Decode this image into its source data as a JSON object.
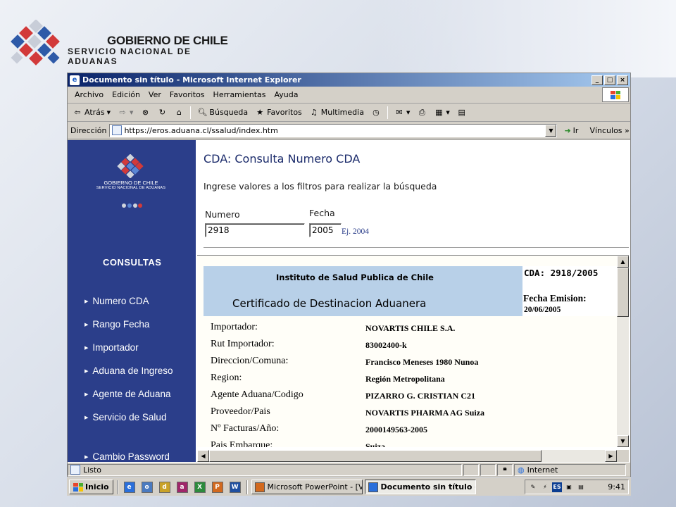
{
  "slide_header": {
    "title": "GOBIERNO DE CHILE",
    "subtitle": "SERVICIO NACIONAL DE ADUANAS"
  },
  "window": {
    "title": "Documento sin título - Microsoft Internet Explorer",
    "buttons": [
      "_",
      "□",
      "×"
    ]
  },
  "menu": [
    "Archivo",
    "Edición",
    "Ver",
    "Favoritos",
    "Herramientas",
    "Ayuda"
  ],
  "toolbar": {
    "back": "Atrás",
    "search": "Búsqueda",
    "favorites": "Favoritos",
    "media": "Multimedia"
  },
  "address": {
    "label": "Dirección",
    "url": "https://eros.aduana.cl/ssalud/index.htm",
    "go": "Ir",
    "links": "Vínculos"
  },
  "sidebar": {
    "logo_title": "GOBIERNO DE CHILE",
    "logo_sub": "SERVICIO NACIONAL DE ADUANAS",
    "heading": "CONSULTAS",
    "items": [
      {
        "label": "Numero CDA"
      },
      {
        "label": "Rango Fecha"
      },
      {
        "label": "Importador"
      },
      {
        "label": "Aduana de Ingreso"
      },
      {
        "label": "Agente de Aduana"
      },
      {
        "label": "Servicio de Salud"
      },
      {
        "label": "Cambio Password"
      }
    ]
  },
  "main": {
    "title": "CDA: Consulta Numero CDA",
    "instructions": "Ingrese valores a los filtros para realizar la búsqueda",
    "numero_label": "Numero",
    "numero_value": "2918",
    "fecha_label": "Fecha",
    "fecha_value": "2005",
    "fecha_hint": "Ej. 2004"
  },
  "certificate": {
    "institute": "Instituto de Salud Publica de Chile",
    "title": "Certificado de Destinacion Aduanera",
    "cda": "CDA: 2918/2005",
    "fecha_emision_label": "Fecha Emision:",
    "fecha_emision": "20/06/2005",
    "rows": [
      {
        "label": "Importador:",
        "value": "NOVARTIS CHILE S.A."
      },
      {
        "label": "Rut Importador:",
        "value": "83002400-k"
      },
      {
        "label": "Direccion/Comuna:",
        "value": "Francisco Meneses 1980 Nunoa"
      },
      {
        "label": "Region:",
        "value": "Región Metropolitana"
      },
      {
        "label": "Agente Aduana/Codigo",
        "value": "PIZARRO G. CRISTIAN C21"
      },
      {
        "label": "Proveedor/Pais",
        "value": "NOVARTIS PHARMA AG Suiza"
      },
      {
        "label": "Nº Facturas/Año:",
        "value": "2000149563-2005"
      },
      {
        "label": "Pais Embarque:",
        "value": "Suiza"
      }
    ]
  },
  "status": {
    "text": "Listo",
    "zone": "Internet"
  },
  "taskbar": {
    "start": "Inicio",
    "tasks": [
      "Microsoft PowerPoint - [V...",
      "Documento sin título -..."
    ],
    "lang": "ES",
    "clock": "9:41"
  }
}
